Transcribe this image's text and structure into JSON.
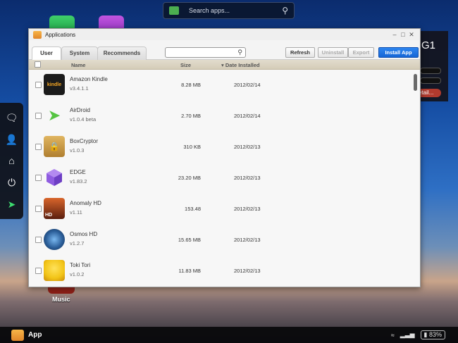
{
  "desktop": {
    "search_placeholder": "Search apps...",
    "music_label": "Music",
    "widget_title": "G1",
    "widget_detail": "etail..."
  },
  "taskbar": {
    "app_label": "App",
    "battery": "83%"
  },
  "window": {
    "title": "Applications",
    "tabs": [
      {
        "label": "User",
        "active": true
      },
      {
        "label": "System",
        "active": false
      },
      {
        "label": "Recommends",
        "active": false
      }
    ],
    "filter_value": "",
    "buttons": {
      "refresh": "Refresh",
      "uninstall": "Uninstall",
      "export": "Export",
      "install": "Install App"
    },
    "columns": {
      "name": "Name",
      "size": "Size",
      "date": "Date Installed"
    },
    "apps": [
      {
        "name": "Amazon Kindle",
        "version": "v3.4.1.1",
        "size": "8.28 MB",
        "date": "2012/02/14",
        "icon": "kindle-icon",
        "icon_text": "kindle",
        "color": "#1b1b1b"
      },
      {
        "name": "AirDroid",
        "version": "v1.0.4 beta",
        "size": "2.70 MB",
        "date": "2012/02/14",
        "icon": "airdroid-icon",
        "icon_text": "",
        "color": "#55c442"
      },
      {
        "name": "BoxCryptor",
        "version": "v1.0.3",
        "size": "310 KB",
        "date": "2012/02/13",
        "icon": "boxcryptor-icon",
        "icon_text": "",
        "color": "#c99a45"
      },
      {
        "name": "EDGE",
        "version": "v1.83.2",
        "size": "23.20 MB",
        "date": "2012/02/13",
        "icon": "edge-icon",
        "icon_text": "",
        "color": "#8f5ce0"
      },
      {
        "name": "Anomaly HD",
        "version": "v1.11",
        "size": "153.48",
        "date": "2012/02/13",
        "icon": "anomaly-icon",
        "icon_text": "HD",
        "color": "#b0431e"
      },
      {
        "name": "Osmos HD",
        "version": "v1.2.7",
        "size": "15.65 MB",
        "date": "2012/02/13",
        "icon": "osmos-icon",
        "icon_text": "",
        "color": "#2c5f9a"
      },
      {
        "name": "Toki Tori",
        "version": "v1.0.2",
        "size": "11.83 MB",
        "date": "2012/02/13",
        "icon": "tokitori-icon",
        "icon_text": "",
        "color": "#f2c417"
      }
    ]
  }
}
